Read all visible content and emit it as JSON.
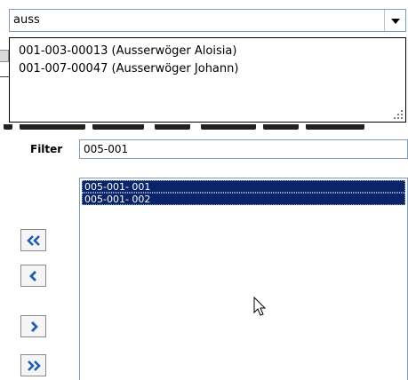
{
  "combo": {
    "value": "auss",
    "options": [
      "001-003-00013 (Ausserwöger Aloisia)",
      "001-007-00047 (Ausserwöger Johann)"
    ]
  },
  "filter": {
    "label": "Filter",
    "value": "005-001"
  },
  "list": {
    "items": [
      "005-001- 001",
      "005-001- 002"
    ]
  },
  "buttons": [
    {
      "name": "move-all-left-button",
      "icon": "double-chevron-left-icon"
    },
    {
      "name": "move-left-button",
      "icon": "chevron-left-icon"
    },
    {
      "name": "move-right-button",
      "icon": "chevron-right-icon"
    },
    {
      "name": "move-all-right-button",
      "icon": "double-chevron-right-icon"
    }
  ],
  "colors": {
    "selection": "#0a246a",
    "button_icon": "#1a5fb4",
    "field_border": "#7f9db9"
  }
}
